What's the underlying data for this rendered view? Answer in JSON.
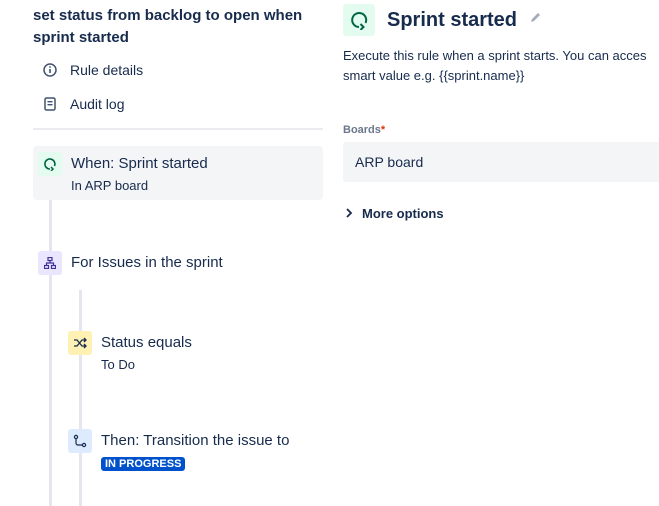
{
  "rule_title": "set status from backlog to open when sprint started",
  "nav": [
    {
      "label": "Rule details",
      "icon": "info-icon"
    },
    {
      "label": "Audit log",
      "icon": "audit-log-icon"
    }
  ],
  "flow": {
    "trigger": {
      "title": "When: Sprint started",
      "subtitle": "In ARP board"
    },
    "branch": {
      "title": "For Issues in the sprint"
    },
    "condition": {
      "title": "Status equals",
      "subtitle": "To Do"
    },
    "action": {
      "title": "Then: Transition the issue to",
      "badge": "IN PROGRESS"
    }
  },
  "panel": {
    "title": "Sprint started",
    "description_line1": "Execute this rule when a sprint starts. You can acces",
    "description_line2": "smart value e.g. {{sprint.name}}",
    "boards_label": "Boards",
    "required_mark": "*",
    "boards_value": "ARP board",
    "more_options": "More options"
  }
}
